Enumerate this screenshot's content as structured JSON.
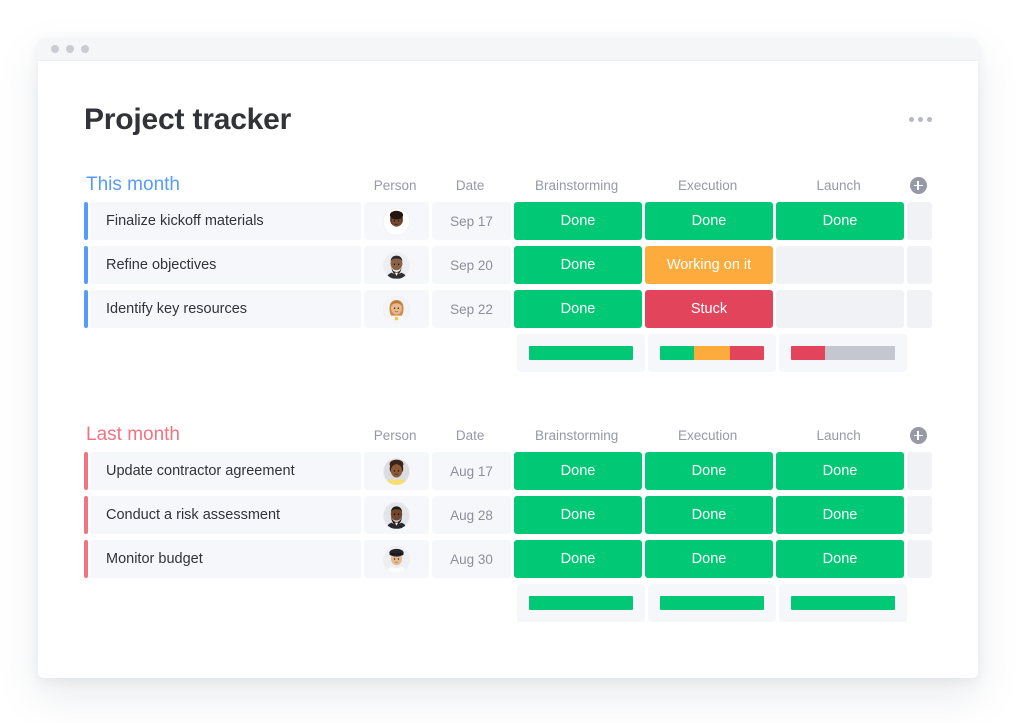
{
  "window": {
    "dots": [
      "window-dot-1",
      "window-dot-2",
      "window-dot-3"
    ]
  },
  "header": {
    "title": "Project tracker",
    "menu_icon": "kebab-menu-icon"
  },
  "columns": {
    "person": "Person",
    "date": "Date",
    "brainstorming": "Brainstorming",
    "execution": "Execution",
    "launch": "Launch",
    "add": "add-column-icon"
  },
  "colors": {
    "done": "#00c875",
    "working": "#fdab3d",
    "stuck": "#e2445c",
    "empty": "#f1f2f6",
    "grey": "#c5c7d0",
    "this_month_accent": "#579bfc",
    "last_month_accent": "#f07481"
  },
  "groups": [
    {
      "id": "this-month",
      "title": "This month",
      "accent": "blue",
      "rows": [
        {
          "name": "Finalize kickoff materials",
          "date": "Sep 17",
          "avatar": "avatar-person-1",
          "statuses": [
            {
              "label": "Done",
              "state": "green"
            },
            {
              "label": "Done",
              "state": "green"
            },
            {
              "label": "Done",
              "state": "green"
            }
          ]
        },
        {
          "name": "Refine objectives",
          "date": "Sep 20",
          "avatar": "avatar-person-2",
          "statuses": [
            {
              "label": "Done",
              "state": "green"
            },
            {
              "label": "Working on it",
              "state": "orange"
            },
            {
              "label": "",
              "state": "empty"
            }
          ]
        },
        {
          "name": "Identify key resources",
          "date": "Sep 22",
          "avatar": "avatar-person-3",
          "statuses": [
            {
              "label": "Done",
              "state": "green"
            },
            {
              "label": "Stuck",
              "state": "red"
            },
            {
              "label": "",
              "state": "empty"
            }
          ]
        }
      ],
      "summary": [
        {
          "segments": [
            {
              "state": "green",
              "pct": 100
            }
          ]
        },
        {
          "segments": [
            {
              "state": "green",
              "pct": 33
            },
            {
              "state": "orange",
              "pct": 34
            },
            {
              "state": "red",
              "pct": 33
            }
          ]
        },
        {
          "segments": [
            {
              "state": "red",
              "pct": 33
            },
            {
              "state": "grey",
              "pct": 67
            }
          ]
        }
      ]
    },
    {
      "id": "last-month",
      "title": "Last month",
      "accent": "red",
      "rows": [
        {
          "name": "Update contractor agreement",
          "date": "Aug 17",
          "avatar": "avatar-person-4",
          "statuses": [
            {
              "label": "Done",
              "state": "green"
            },
            {
              "label": "Done",
              "state": "green"
            },
            {
              "label": "Done",
              "state": "green"
            }
          ]
        },
        {
          "name": "Conduct a risk assessment",
          "date": "Aug 28",
          "avatar": "avatar-person-5",
          "statuses": [
            {
              "label": "Done",
              "state": "green"
            },
            {
              "label": "Done",
              "state": "green"
            },
            {
              "label": "Done",
              "state": "green"
            }
          ]
        },
        {
          "name": "Monitor budget",
          "date": "Aug 30",
          "avatar": "avatar-person-6",
          "statuses": [
            {
              "label": "Done",
              "state": "green"
            },
            {
              "label": "Done",
              "state": "green"
            },
            {
              "label": "Done",
              "state": "green"
            }
          ]
        }
      ],
      "summary": [
        {
          "segments": [
            {
              "state": "green",
              "pct": 100
            }
          ]
        },
        {
          "segments": [
            {
              "state": "green",
              "pct": 100
            }
          ]
        },
        {
          "segments": [
            {
              "state": "green",
              "pct": 100
            }
          ]
        }
      ]
    }
  ]
}
